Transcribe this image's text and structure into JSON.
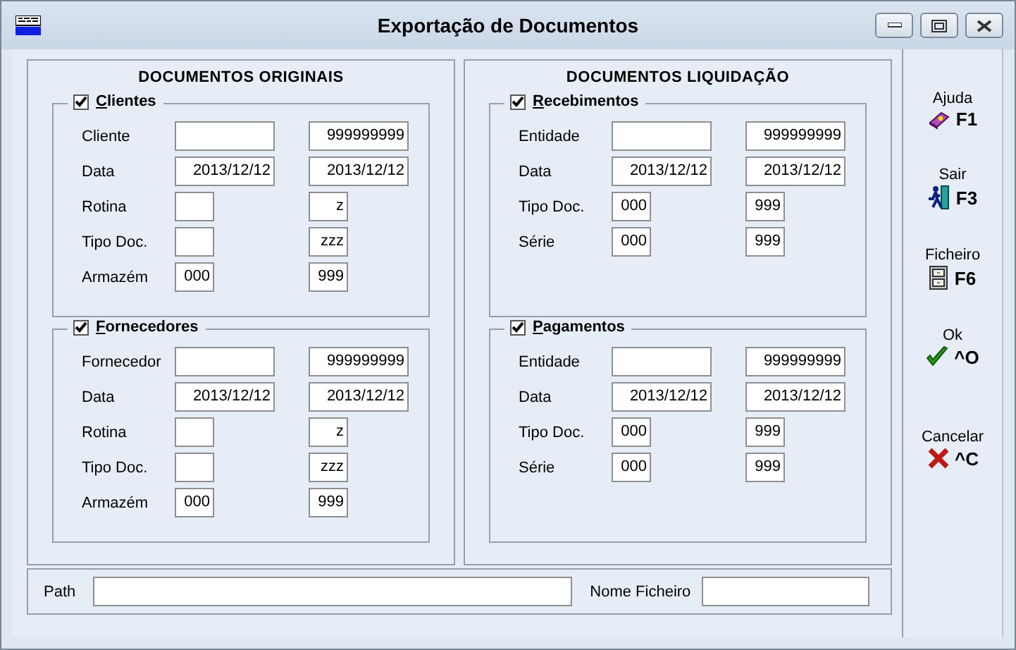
{
  "window": {
    "title": "Exportação de Documentos"
  },
  "panels": [
    {
      "title": "DOCUMENTOS ORIGINAIS",
      "groups": [
        {
          "label": "Clientes",
          "checked": true,
          "rows": [
            {
              "label": "Cliente",
              "kind": "wide",
              "to": "999999999"
            },
            {
              "label": "Data",
              "kind": "wide",
              "from": "2013/12/12",
              "to": "2013/12/12"
            },
            {
              "label": "Rotina",
              "kind": "narrow",
              "to": "z"
            },
            {
              "label": "Tipo Doc.",
              "kind": "narrow",
              "to": "zzz"
            },
            {
              "label": "Armazém",
              "kind": "narrow",
              "from": "000",
              "to": "999"
            }
          ]
        },
        {
          "label": "Fornecedores",
          "checked": true,
          "rows": [
            {
              "label": "Fornecedor",
              "kind": "wide",
              "to": "999999999"
            },
            {
              "label": "Data",
              "kind": "wide",
              "from": "2013/12/12",
              "to": "2013/12/12"
            },
            {
              "label": "Rotina",
              "kind": "narrow",
              "to": "z"
            },
            {
              "label": "Tipo Doc.",
              "kind": "narrow",
              "to": "zzz"
            },
            {
              "label": "Armazém",
              "kind": "narrow",
              "from": "000",
              "to": "999"
            }
          ]
        }
      ]
    },
    {
      "title": "DOCUMENTOS LIQUIDAÇÃO",
      "groups": [
        {
          "label": "Recebimentos",
          "checked": true,
          "rows": [
            {
              "label": "Entidade",
              "kind": "wide",
              "to": "999999999"
            },
            {
              "label": "Data",
              "kind": "wide",
              "from": "2013/12/12",
              "to": "2013/12/12"
            },
            {
              "label": "Tipo Doc.",
              "kind": "narrow",
              "from": "000",
              "to": "999"
            },
            {
              "label": "Série",
              "kind": "narrow",
              "from": "000",
              "to": "999"
            }
          ]
        },
        {
          "label": "Pagamentos",
          "checked": true,
          "rows": [
            {
              "label": "Entidade",
              "kind": "wide",
              "to": "999999999"
            },
            {
              "label": "Data",
              "kind": "wide",
              "from": "2013/12/12",
              "to": "2013/12/12"
            },
            {
              "label": "Tipo Doc.",
              "kind": "narrow",
              "from": "000",
              "to": "999"
            },
            {
              "label": "Série",
              "kind": "narrow",
              "from": "000",
              "to": "999"
            }
          ]
        }
      ]
    }
  ],
  "actions": [
    {
      "label": "Ajuda",
      "key": "F1",
      "kind": "help"
    },
    {
      "label": "Sair",
      "key": "F3",
      "kind": "exit"
    },
    {
      "label": "Ficheiro",
      "key": "F6",
      "kind": "file"
    },
    {
      "label": "Ok",
      "key": "^O",
      "kind": "ok"
    },
    {
      "label": "Cancelar",
      "key": "^C",
      "kind": "cancel"
    }
  ],
  "path": {
    "label": "Path"
  },
  "file_name": {
    "label": "Nome Ficheiro"
  }
}
